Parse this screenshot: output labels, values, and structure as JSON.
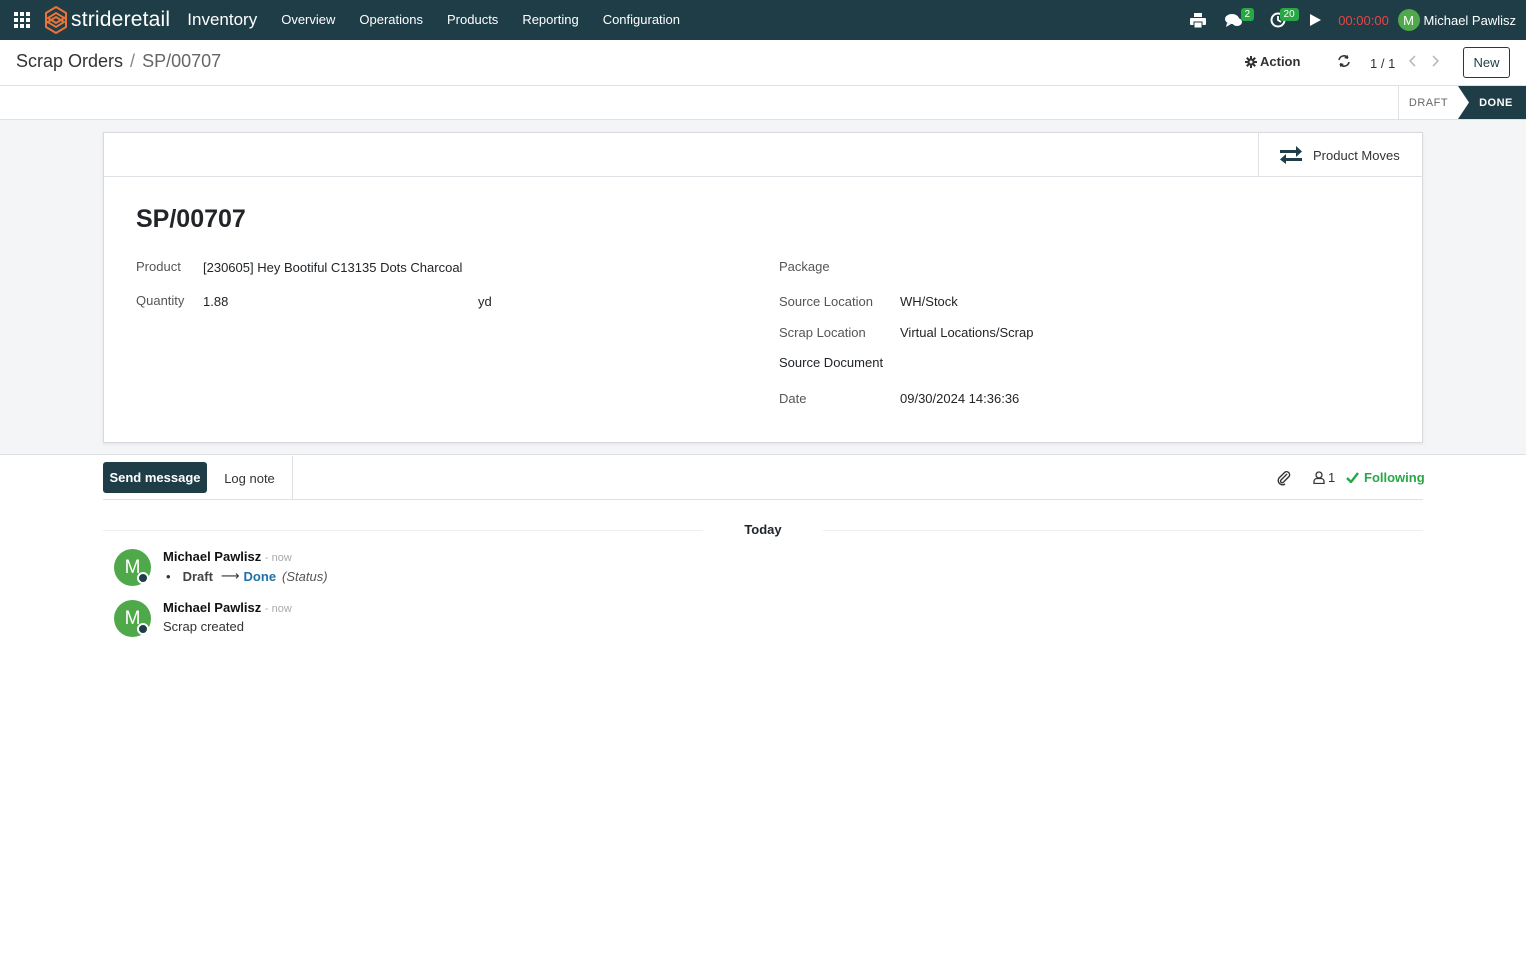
{
  "navbar": {
    "brand": {
      "part1": "stride",
      "part2": "retail"
    },
    "app_title": "Inventory",
    "menu": [
      "Overview",
      "Operations",
      "Products",
      "Reporting",
      "Configuration"
    ],
    "messages_badge": "2",
    "activities_badge": "20",
    "timer": "00:00:00",
    "user_initial": "M",
    "user_name": "Michael Pawlisz"
  },
  "control": {
    "breadcrumb_parent": "Scrap Orders",
    "breadcrumb_sep": "/",
    "breadcrumb_current": "SP/00707",
    "action_label": "Action",
    "pager": "1 / 1",
    "new_label": "New"
  },
  "statusbar": {
    "stages": [
      "DRAFT",
      "DONE"
    ],
    "active": "DONE"
  },
  "form": {
    "smart_button": "Product Moves",
    "title": "SP/00707",
    "left": {
      "product_label": "Product",
      "product_value": "[230605] Hey Bootiful C13135 Dots Charcoal",
      "quantity_label": "Quantity",
      "quantity_value": "1.88",
      "uom": "yd"
    },
    "right": {
      "package_label": "Package",
      "source_location_label": "Source Location",
      "source_location_value": "WH/Stock",
      "scrap_location_label": "Scrap Location",
      "scrap_location_value": "Virtual Locations/Scrap",
      "source_document_label": "Source Document",
      "date_label": "Date",
      "date_value": "09/30/2024 14:36:36"
    }
  },
  "chatter": {
    "send_message": "Send message",
    "log_note": "Log note",
    "followers_count": "1",
    "following": "Following",
    "today": "Today",
    "messages": [
      {
        "initial": "M",
        "author": "Michael Pawlisz",
        "time": "- now",
        "from": "Draft",
        "to": "Done",
        "field": "(Status)"
      },
      {
        "initial": "M",
        "author": "Michael Pawlisz",
        "time": "- now",
        "body": "Scrap created"
      }
    ]
  },
  "colors": {
    "primary": "#1e3d47",
    "success": "#28a745",
    "avatar": "#4fa84a",
    "timer": "#e04848",
    "link": "#1f6fa9"
  }
}
